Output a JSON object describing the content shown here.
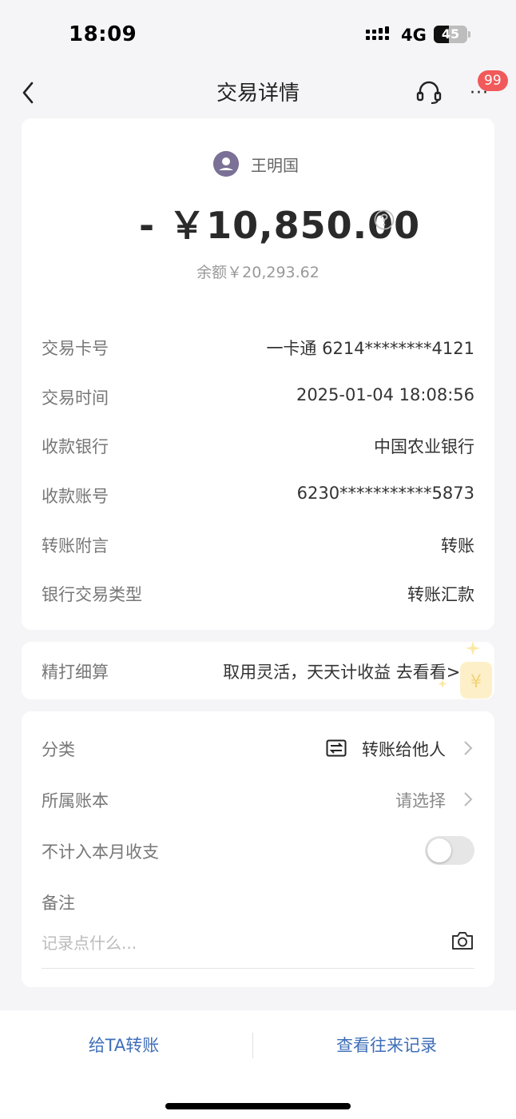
{
  "status_bar": {
    "time": "18:09",
    "network": "4G",
    "battery": "45",
    "battery_level": 0.45
  },
  "nav": {
    "title": "交易详情",
    "badge": "99",
    "more_dots": "···"
  },
  "transaction": {
    "payee": "王明国",
    "amount": "- ￥10,850.00",
    "balance": "余额￥20,293.62"
  },
  "details": [
    {
      "label": "交易卡号",
      "value": "一卡通 6214********4121"
    },
    {
      "label": "交易时间",
      "value": "2025-01-04 18:08:56"
    },
    {
      "label": "收款银行",
      "value": "中国农业银行"
    },
    {
      "label": "收款账号",
      "value": "6230***********5873"
    },
    {
      "label": "转账附言",
      "value": "转账"
    },
    {
      "label": "银行交易类型",
      "value": "转账汇款"
    }
  ],
  "promo": {
    "label": "精打细算",
    "text": "取用灵活，天天计收益 去看看>>"
  },
  "settings": {
    "category": {
      "label": "分类",
      "value": "转账给他人"
    },
    "ledger": {
      "label": "所属账本",
      "value": "请选择"
    },
    "exclude": {
      "label": "不计入本月收支",
      "on": false
    },
    "note": {
      "label": "备注",
      "placeholder": "记录点什么..."
    }
  },
  "bottom": {
    "left": "给TA转账",
    "right": "查看往来记录"
  },
  "colors": {
    "accent": "#3f6fb8",
    "badge": "#f15a5a",
    "avatar": "#7b7095"
  }
}
